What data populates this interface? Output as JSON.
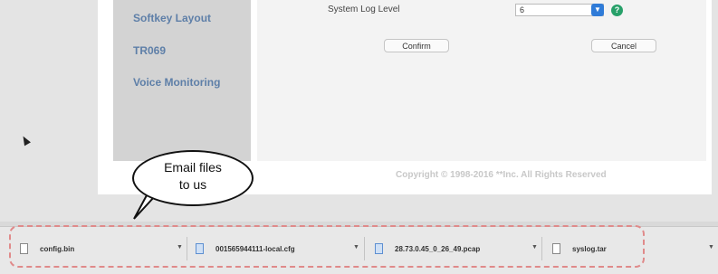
{
  "sidebar": {
    "items": [
      {
        "label": "Softkey Layout"
      },
      {
        "label": "TR069"
      },
      {
        "label": "Voice Monitoring"
      }
    ]
  },
  "form": {
    "field_label": "System Log Level",
    "select_value": "6",
    "confirm_label": "Confirm",
    "cancel_label": "Cancel"
  },
  "footer": {
    "copyright": "Copyright © 1998-2016 **Inc. All Rights Reserved"
  },
  "callout": {
    "text": "Email files\nto us"
  },
  "downloads": [
    {
      "name": "config.bin",
      "icon": "file-icon"
    },
    {
      "name": "001565944111-local.cfg",
      "icon": "config-file-icon"
    },
    {
      "name": "28.73.0.45_0_26_49.pcap",
      "icon": "document-icon"
    },
    {
      "name": "syslog.tar",
      "icon": "file-icon"
    }
  ],
  "colors": {
    "sidebar_link": "#5e7fa8",
    "highlight_dashes": "#e08a8a",
    "help_icon": "#27a069",
    "select_arrow": "#2f7bd8"
  }
}
